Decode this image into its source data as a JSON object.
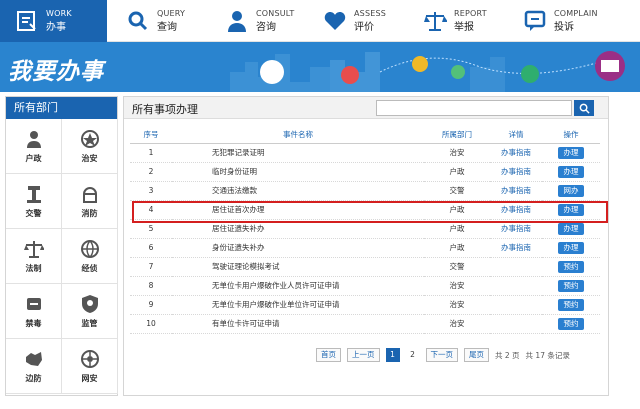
{
  "nav": [
    {
      "en": "WORK",
      "zh": "办事",
      "icon": "work-icon",
      "active": true
    },
    {
      "en": "QUERY",
      "zh": "查询",
      "icon": "search-icon",
      "active": false
    },
    {
      "en": "CONSULT",
      "zh": "咨询",
      "icon": "person-icon",
      "active": false
    },
    {
      "en": "ASSESS",
      "zh": "评价",
      "icon": "heart-icon",
      "active": false
    },
    {
      "en": "REPORT",
      "zh": "举报",
      "icon": "scales-icon",
      "active": false
    },
    {
      "en": "COMPLAIN",
      "zh": "投诉",
      "icon": "chat-icon",
      "active": false
    }
  ],
  "banner": {
    "title": "我要办事"
  },
  "left": {
    "title": "所有部门",
    "depts": [
      {
        "label": "户政",
        "icon": "household-icon"
      },
      {
        "label": "治安",
        "icon": "police-badge-icon"
      },
      {
        "label": "交警",
        "icon": "traffic-police-icon"
      },
      {
        "label": "消防",
        "icon": "fire-icon"
      },
      {
        "label": "法制",
        "icon": "scales-icon"
      },
      {
        "label": "经侦",
        "icon": "globe-icon"
      },
      {
        "label": "禁毒",
        "icon": "anti-drug-icon"
      },
      {
        "label": "监管",
        "icon": "shield-icon"
      },
      {
        "label": "边防",
        "icon": "map-icon"
      },
      {
        "label": "网安",
        "icon": "network-icon"
      }
    ]
  },
  "main": {
    "title": "所有事项办理",
    "search": {
      "value": "",
      "placeholder": ""
    },
    "columns": [
      "序号",
      "事件名称",
      "所属部门",
      "详情",
      "操作"
    ],
    "rows": [
      {
        "no": "1",
        "name": "无犯罪记录证明",
        "dept": "治安",
        "guide": "办事指南",
        "op": "办理"
      },
      {
        "no": "2",
        "name": "临时身份证明",
        "dept": "户政",
        "guide": "办事指南",
        "op": "办理"
      },
      {
        "no": "3",
        "name": "交通违法缴款",
        "dept": "交警",
        "guide": "办事指南",
        "op": "网办"
      },
      {
        "no": "4",
        "name": "居住证首次办理",
        "dept": "户政",
        "guide": "办事指南",
        "op": "办理"
      },
      {
        "no": "5",
        "name": "居住证遗失补办",
        "dept": "户政",
        "guide": "办事指南",
        "op": "办理"
      },
      {
        "no": "6",
        "name": "身份证遗失补办",
        "dept": "户政",
        "guide": "办事指南",
        "op": "办理"
      },
      {
        "no": "7",
        "name": "驾驶证理论模拟考试",
        "dept": "交警",
        "guide": "",
        "op": "预约"
      },
      {
        "no": "8",
        "name": "无单位卡用户爆破作业人员许可证申请",
        "dept": "治安",
        "guide": "",
        "op": "预约"
      },
      {
        "no": "9",
        "name": "无单位卡用户爆破作业单位许可证申请",
        "dept": "治安",
        "guide": "",
        "op": "预约"
      },
      {
        "no": "10",
        "name": "有单位卡许可证申请",
        "dept": "治安",
        "guide": "",
        "op": "预约"
      }
    ],
    "pager": {
      "first": "首页",
      "prev": "上一页",
      "pages": [
        "1",
        "2"
      ],
      "current": "1",
      "next": "下一页",
      "last": "尾页",
      "total_pages": "共 2 页",
      "total_records": "共 17 条记录"
    },
    "highlight_row": "4"
  },
  "colors": {
    "accent": "#1a64b0",
    "banner": "#2a84cf",
    "highlight": "#d41f1f"
  }
}
